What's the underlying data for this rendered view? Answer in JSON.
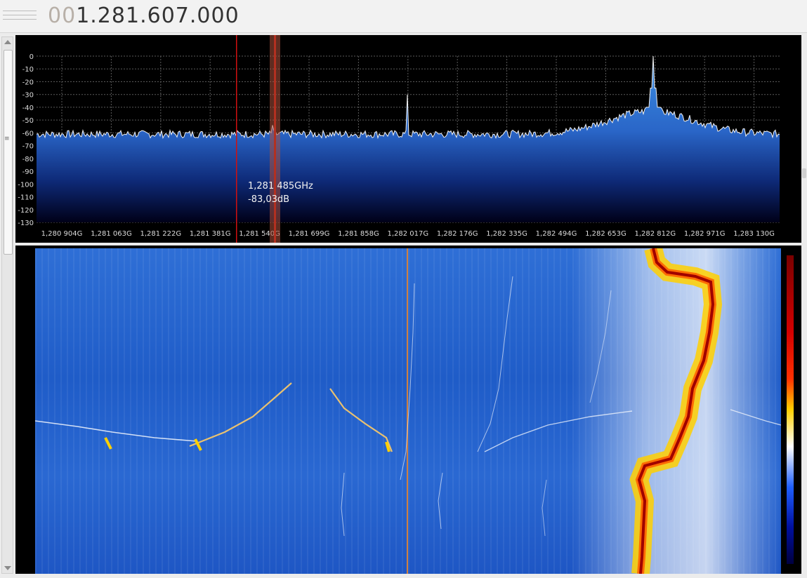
{
  "frequency_display": {
    "leading_digits": "00",
    "value": "1.281.607.000"
  },
  "spectrum": {
    "y_axis_labels": [
      "0",
      "-10",
      "-20",
      "-30",
      "-40",
      "-50",
      "-60",
      "-70",
      "-80",
      "-90",
      "-100",
      "-110",
      "-120",
      "-130"
    ],
    "x_axis_labels": [
      "1,280 904G",
      "1,281 063G",
      "1,281 222G",
      "1,281 381G",
      "1,281 540G",
      "1,281 699G",
      "1,281 858G",
      "1,282 017G",
      "1,282 176G",
      "1,282 335G",
      "1,282 494G",
      "1,282 653G",
      "1,282 812G",
      "1,282 971G",
      "1,283 130G"
    ],
    "cursor_readout": {
      "frequency": "1,281 485GHz",
      "level": "-83,03dB"
    },
    "colors": {
      "trace": "#ffffff",
      "fill_top": "#3a8fe0",
      "fill_bottom": "#000010",
      "grid": "#6a6a6a",
      "marker_red": "#d01010"
    }
  },
  "waterfall": {
    "colors": {
      "background": "#2a66d0",
      "signal_core": "#c80000",
      "signal_edge": "#ffd000",
      "center_marker": "#d08040"
    }
  },
  "icons": {
    "drag_handle": "grip-lines-icon",
    "scroll_up": "scroll-up-arrow-icon",
    "scroll_down": "scroll-down-arrow-icon"
  }
}
